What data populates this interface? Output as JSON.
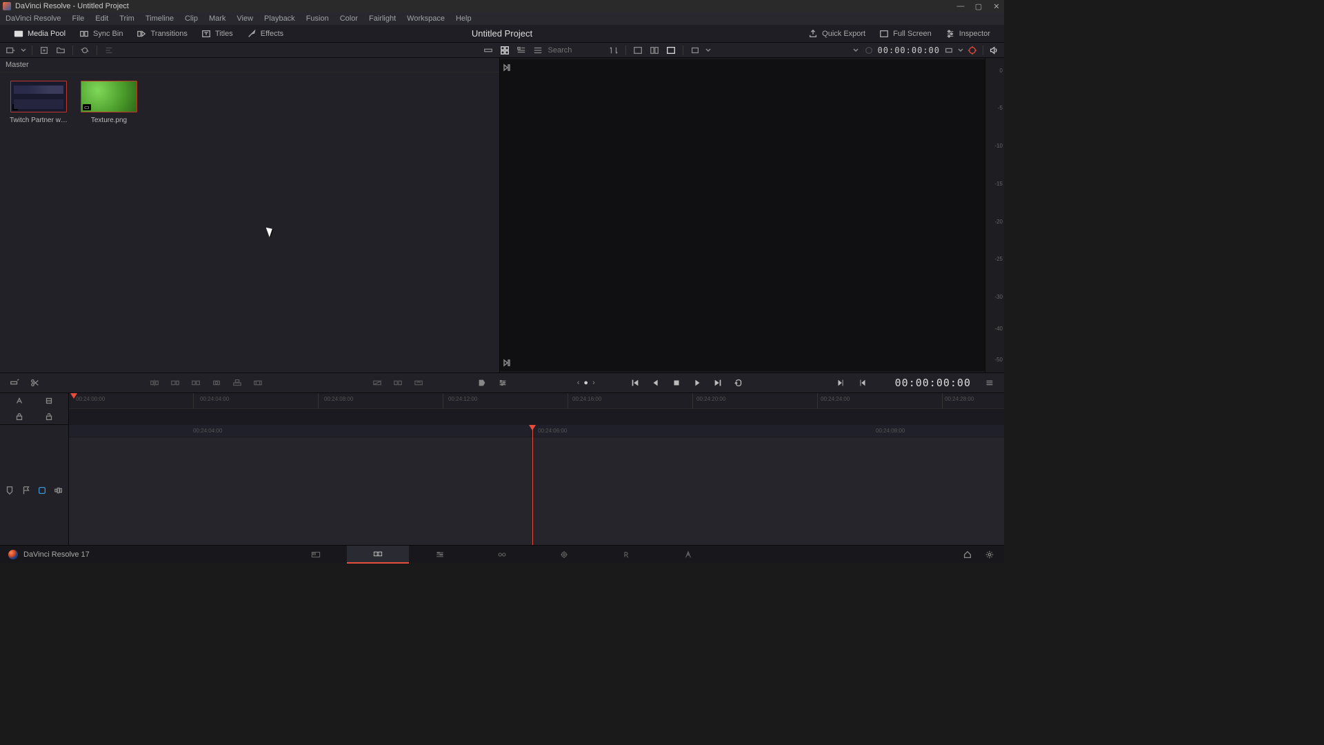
{
  "window": {
    "title": "DaVinci Resolve - Untitled Project"
  },
  "menu": [
    "DaVinci Resolve",
    "File",
    "Edit",
    "Trim",
    "Timeline",
    "Clip",
    "Mark",
    "View",
    "Playback",
    "Fusion",
    "Color",
    "Fairlight",
    "Workspace",
    "Help"
  ],
  "workspace": {
    "left": [
      {
        "id": "media-pool",
        "label": "Media Pool"
      },
      {
        "id": "sync-bin",
        "label": "Sync Bin"
      },
      {
        "id": "transitions",
        "label": "Transitions"
      },
      {
        "id": "titles",
        "label": "Titles"
      },
      {
        "id": "effects",
        "label": "Effects"
      }
    ],
    "project_title": "Untitled Project",
    "right": [
      {
        "id": "quick-export",
        "label": "Quick Export"
      },
      {
        "id": "full-screen",
        "label": "Full Screen"
      },
      {
        "id": "inspector",
        "label": "Inspector"
      }
    ]
  },
  "media_toolbar": {
    "search_placeholder": "Search",
    "timecode": "00:00:00:00"
  },
  "media": {
    "bin_label": "Master",
    "items": [
      {
        "id": "clip1",
        "label": "Twitch Partner we...",
        "type": "video"
      },
      {
        "id": "clip2",
        "label": "Texture.png",
        "type": "image"
      }
    ]
  },
  "audio_meter_ticks": [
    "0",
    "-5",
    "-10",
    "-15",
    "-20",
    "-25",
    "-30",
    "-40",
    "-50"
  ],
  "ruler_marks_top": [
    "00:24:00:00",
    "00:24:04:00",
    "00:24:08:00",
    "00:24:12:00",
    "00:24:16:00",
    "00:24:20:00",
    "00:24:24:00",
    "00:24:28:00"
  ],
  "ruler_marks_track": [
    "00:24:04:00",
    "00:24:06:00",
    "00:24:08:00"
  ],
  "transport": {
    "timecode": "00:00:00:00"
  },
  "app_footer": {
    "label": "DaVinci Resolve 17"
  }
}
